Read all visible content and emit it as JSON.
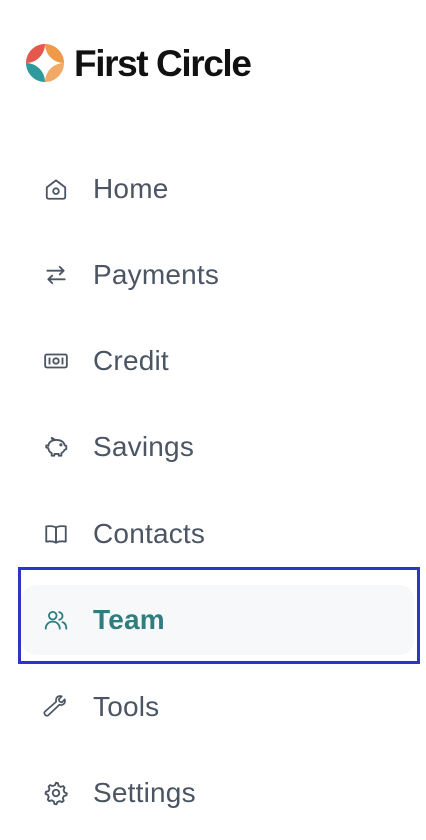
{
  "brand": {
    "name": "First Circle",
    "colors": {
      "red": "#e4584e",
      "teal": "#2f9a9c",
      "orange": "#ef9a4a",
      "blue": "#6b9fcf"
    }
  },
  "theme": {
    "active_color": "#2f7d7f",
    "text_color": "#4b5563",
    "selection_frame_color": "#2c35c4"
  },
  "nav": {
    "items": [
      {
        "label": "Home",
        "icon": "home-icon"
      },
      {
        "label": "Payments",
        "icon": "arrows-left-right-icon"
      },
      {
        "label": "Credit",
        "icon": "banknote-icon"
      },
      {
        "label": "Savings",
        "icon": "piggy-bank-icon"
      },
      {
        "label": "Contacts",
        "icon": "book-icon"
      },
      {
        "label": "Team",
        "icon": "users-icon",
        "active": true
      },
      {
        "label": "Tools",
        "icon": "wrench-icon"
      },
      {
        "label": "Settings",
        "icon": "gear-icon"
      }
    ]
  }
}
